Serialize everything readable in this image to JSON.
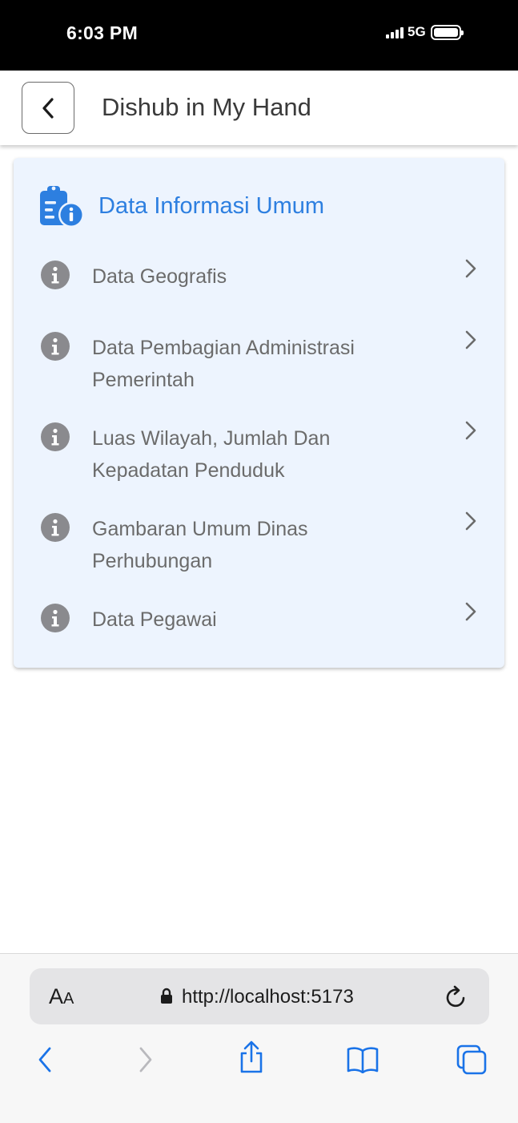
{
  "status_bar": {
    "time": "6:03 PM",
    "network": "5G"
  },
  "header": {
    "title": "Dishub in My Hand",
    "back_icon": "chevron-left-icon"
  },
  "card": {
    "title": "Data Informasi Umum",
    "header_icon": "clipboard-info-icon",
    "items": [
      {
        "label": "Data Geografis",
        "icon": "info-icon"
      },
      {
        "label": "Data Pembagian Administrasi Pemerintah",
        "icon": "info-icon"
      },
      {
        "label": "Luas Wilayah, Jumlah Dan Kepadatan Penduduk",
        "icon": "info-icon"
      },
      {
        "label": "Gambaran Umum Dinas Perhubungan",
        "icon": "info-icon"
      },
      {
        "label": "Data Pegawai",
        "icon": "info-icon"
      }
    ]
  },
  "browser": {
    "text_size_label_big": "A",
    "text_size_label_small": "A",
    "url": "http://localhost:5173",
    "accent_color": "#1a73e8"
  },
  "colors": {
    "card_background": "#edf4fe",
    "title_blue": "#2d7fe0",
    "item_text": "#6b6b6b",
    "info_icon": "#8a8a8e"
  }
}
